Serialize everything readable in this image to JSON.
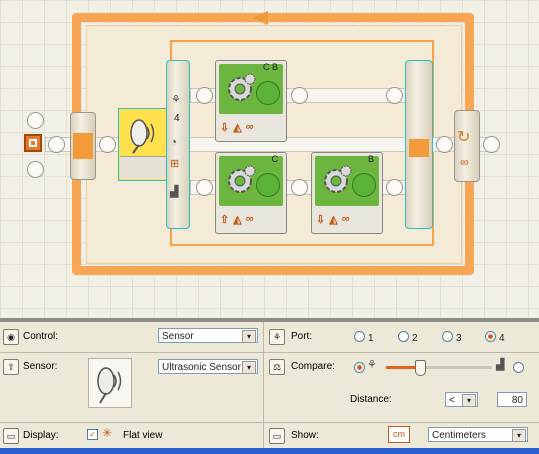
{
  "canvas": {
    "switch_input_value": "4",
    "blocks": [
      {
        "id": "top",
        "port_label": "C B",
        "direction_icon": "down-arrow",
        "steer_icon": "steer",
        "duration_icon": "infinity"
      },
      {
        "id": "bottom-left",
        "port_label": "C",
        "direction_icon": "up-arrow",
        "steer_icon": "steer",
        "duration_icon": "infinity"
      },
      {
        "id": "bottom-right",
        "port_label": "B",
        "direction_icon": "down-arrow",
        "steer_icon": "steer",
        "duration_icon": "infinity"
      }
    ],
    "loop_icon": "loop-arrows-icon",
    "loop_infinity": "∞"
  },
  "panel": {
    "control_label": "Control:",
    "control_value": "Sensor",
    "sensor_label": "Sensor:",
    "sensor_value": "Ultrasonic Sensor",
    "display_label": "Display:",
    "display_checkbox": "Flat view",
    "port_label": "Port:",
    "ports": [
      "1",
      "2",
      "3",
      "4"
    ],
    "selected_port": "4",
    "compare_label": "Compare:",
    "distance_label": "Distance:",
    "distance_op": "<",
    "distance_value": "80",
    "show_label": "Show:",
    "unit_badge": "cm",
    "unit_value": "Centimeters"
  },
  "colors": {
    "accent": "#f7a24a",
    "green": "#6cb640",
    "highlight": "#ffe14d",
    "teal": "#2ebfbf"
  }
}
